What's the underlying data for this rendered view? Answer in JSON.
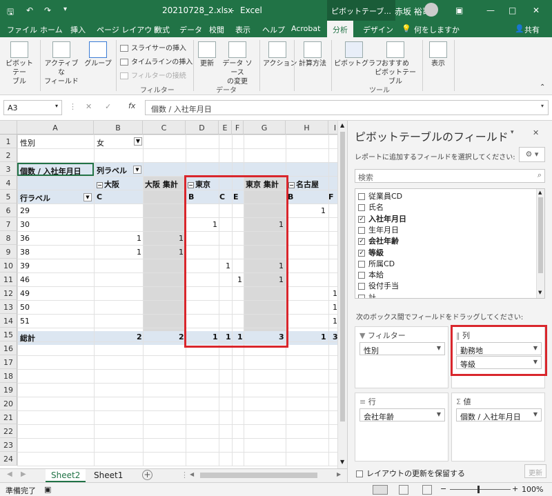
{
  "window": {
    "filename": "20210728_2.xlsx",
    "app": "Excel",
    "context_tab": "ピボットテーブ...",
    "user": "赤坂 裕司"
  },
  "tabs": [
    "ファイル",
    "ホーム",
    "挿入",
    "ページ レイアウト",
    "数式",
    "データ",
    "校閲",
    "表示",
    "ヘルプ",
    "Acrobat",
    "分析",
    "デザイン"
  ],
  "active_tab": "分析",
  "tell_me": "何をしますか",
  "share": "共有",
  "ribbon": {
    "pivottable": "ピボットテー\nブル",
    "active_field": "アクティブな\nフィールド",
    "group": "グループ",
    "insert_slicer": "スライサーの挿入",
    "insert_timeline": "タイムラインの挿入",
    "filter_connections": "フィルターの接続",
    "filter_group": "フィルター",
    "refresh": "更新",
    "change_source": "データ ソース\nの変更",
    "data_group": "データ",
    "actions": "アクション",
    "calculations": "計算方法",
    "pivotchart": "ピボットグラフ",
    "recommended": "おすすめ\nピボットテーブル",
    "tools_group": "ツール",
    "show": "表示"
  },
  "formula_bar": {
    "namebox": "A3",
    "content": "個数 / 入社年月日"
  },
  "grid": {
    "columns": [
      "A",
      "B",
      "C",
      "D",
      "E",
      "F",
      "G",
      "H",
      "I"
    ],
    "rows": [
      "1",
      "2",
      "3",
      "4",
      "5",
      "6",
      "7",
      "8",
      "9",
      "10",
      "11",
      "12",
      "13",
      "14",
      "15",
      "16",
      "17",
      "18",
      "19",
      "20",
      "21",
      "22",
      "23",
      "24"
    ],
    "a1": "性別",
    "b1": "女",
    "a3": "個数 / 入社年月日",
    "b3": "列ラベル",
    "b4": "大阪",
    "c4": "大阪 集計",
    "d4": "東京",
    "g4": "東京 集計",
    "h4": "名古屋",
    "a5": "行ラベル",
    "b5": "C",
    "d5": "B",
    "d5c": "C",
    "e5": "E",
    "h5": "B",
    "h5f": "F",
    "row_labels": [
      "29",
      "30",
      "36",
      "38",
      "39",
      "46",
      "49",
      "50",
      "51"
    ],
    "total_label": "総計",
    "values": {
      "r6_h": "1",
      "r7_d": "1",
      "r7_g": "1",
      "r8_b": "1",
      "r8_c": "1",
      "r9_b": "1",
      "r9_c": "1",
      "r10_e": "1",
      "r10_g": "1",
      "r11_f": "1",
      "r11_g": "1",
      "r12_i": "1",
      "r13_i": "1",
      "r14_i": "1"
    },
    "totals": {
      "b": "2",
      "c": "2",
      "d": "1",
      "e": "1",
      "f": "1",
      "g": "3",
      "h": "1",
      "i": "3"
    }
  },
  "sheets": [
    "Sheet2",
    "Sheet1"
  ],
  "active_sheet": "Sheet2",
  "status": {
    "ready": "準備完了",
    "zoom": "100%"
  },
  "pane": {
    "title": "ピボットテーブルのフィールド",
    "subtitle": "レポートに追加するフィールドを選択してください:",
    "search_placeholder": "検索",
    "fields": [
      {
        "label": "従業員CD",
        "checked": false
      },
      {
        "label": "氏名",
        "checked": false
      },
      {
        "label": "入社年月日",
        "checked": true
      },
      {
        "label": "生年月日",
        "checked": false
      },
      {
        "label": "会社年齢",
        "checked": true
      },
      {
        "label": "等級",
        "checked": true
      },
      {
        "label": "所属CD",
        "checked": false
      },
      {
        "label": "本給",
        "checked": false
      },
      {
        "label": "役付手当",
        "checked": false
      },
      {
        "label": "計",
        "checked": false
      }
    ],
    "drag_hint": "次のボックス間でフィールドをドラッグしてください:",
    "filter_label": "フィルター",
    "filter_items": [
      "性別"
    ],
    "columns_label": "列",
    "column_items": [
      "勤務地",
      "等級"
    ],
    "rows_label": "行",
    "row_items": [
      "会社年齢"
    ],
    "values_label": "値",
    "value_items": [
      "個数 / 入社年月日"
    ],
    "defer_label": "レイアウトの更新を保留する",
    "update_label": "更新"
  },
  "colors": {
    "excel_green": "#217346",
    "highlight_red": "#d9262c",
    "pivot_header": "#dce6f1"
  }
}
